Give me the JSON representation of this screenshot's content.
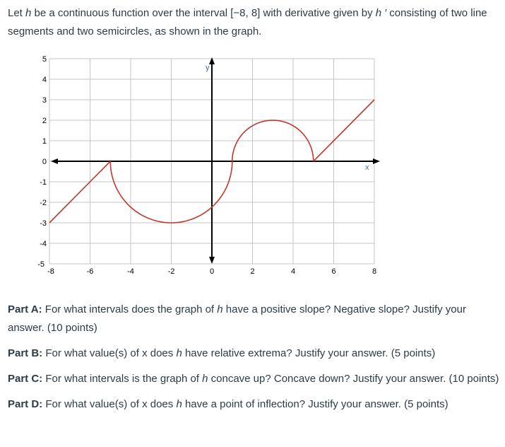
{
  "intro": {
    "text_1": "Let ",
    "var_h": "h",
    "text_2": " be a continuous function over the interval [−8, 8] with derivative given by ",
    "var_hprime": "h ′",
    "text_3": " consisting of two line segments and two semicircles, as shown in the graph."
  },
  "chart_data": {
    "type": "line",
    "title": "",
    "xlabel": "x",
    "ylabel": "y",
    "xlim": [
      -8,
      8
    ],
    "ylim": [
      -5,
      5
    ],
    "grid": true,
    "x_ticks": [
      -8,
      -6,
      -4,
      -2,
      0,
      2,
      4,
      6,
      8
    ],
    "y_ticks": [
      -5,
      -4,
      -3,
      -2,
      -1,
      0,
      1,
      2,
      3,
      4,
      5
    ],
    "curve_color": "#c0392b",
    "series": [
      {
        "name": "h'",
        "pieces": [
          {
            "kind": "segment",
            "from": [
              -8,
              -3
            ],
            "to": [
              -5,
              0
            ]
          },
          {
            "kind": "semicircle",
            "center": [
              -2,
              0
            ],
            "radius": 3,
            "half": "lower",
            "x_range": [
              -5,
              1
            ]
          },
          {
            "kind": "semicircle",
            "center": [
              3,
              0
            ],
            "radius": 2,
            "half": "upper",
            "x_range": [
              1,
              5
            ]
          },
          {
            "kind": "segment",
            "from": [
              5,
              0
            ],
            "to": [
              8,
              3
            ]
          }
        ]
      }
    ]
  },
  "parts": [
    {
      "label": "Part A:",
      "text_1": " For what intervals does the graph of ",
      "var": "h",
      "text_2": " have a positive slope? Negative slope? Justify your answer. (10 points)"
    },
    {
      "label": "Part B:",
      "text_1": " For what value(s) of x does ",
      "var": "h",
      "text_2": " have relative extrema? Justify your answer. (5 points)"
    },
    {
      "label": "Part C:",
      "text_1": " For what intervals is the graph of ",
      "var": "h",
      "text_2": " concave up? Concave down? Justify your answer. (10 points)"
    },
    {
      "label": "Part D:",
      "text_1": " For what value(s) of x does ",
      "var": "h",
      "text_2": " have a point of inflection? Justify your answer. (5 points)"
    }
  ]
}
